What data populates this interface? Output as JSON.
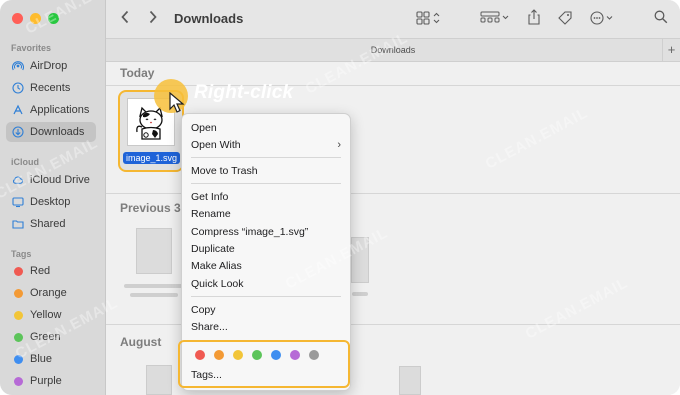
{
  "window": {
    "title": "Downloads",
    "pathbar": "Downloads"
  },
  "colors": {
    "close": "#ff5f57",
    "minimize": "#febc2e",
    "zoom": "#28c840",
    "highlight": "#f5b732",
    "selection": "#1f63d8"
  },
  "sidebar": {
    "favorites_label": "Favorites",
    "favorites": [
      {
        "label": "AirDrop",
        "icon": "airdrop-icon"
      },
      {
        "label": "Recents",
        "icon": "clock-icon"
      },
      {
        "label": "Applications",
        "icon": "applications-icon"
      },
      {
        "label": "Downloads",
        "icon": "download-icon",
        "active": true
      }
    ],
    "icloud_label": "iCloud",
    "icloud": [
      {
        "label": "iCloud Drive",
        "icon": "cloud-icon"
      },
      {
        "label": "Desktop",
        "icon": "desktop-icon"
      },
      {
        "label": "Shared",
        "icon": "shared-folder-icon"
      }
    ],
    "tags_label": "Tags",
    "tags": [
      {
        "label": "Red",
        "color": "#f05a52"
      },
      {
        "label": "Orange",
        "color": "#f39a35"
      },
      {
        "label": "Yellow",
        "color": "#f2c538"
      },
      {
        "label": "Green",
        "color": "#5cc45a"
      },
      {
        "label": "Blue",
        "color": "#3f8ef0"
      },
      {
        "label": "Purple",
        "color": "#b66ad6"
      }
    ]
  },
  "groups": {
    "today": "Today",
    "previous": "Previous 3",
    "august": "August"
  },
  "file": {
    "name": "image_1.svg"
  },
  "annotation": "Right-click",
  "context_menu": {
    "items_a": [
      "Open",
      "Open With"
    ],
    "items_b": [
      "Move to Trash"
    ],
    "items_c": [
      "Get Info",
      "Rename",
      "Compress “image_1.svg”",
      "Duplicate",
      "Make Alias",
      "Quick Look"
    ],
    "items_d": [
      "Copy",
      "Share..."
    ],
    "tag_colors": [
      "#f05a52",
      "#f39a35",
      "#f2c538",
      "#5cc45a",
      "#3f8ef0",
      "#b66ad6",
      "#9a9a9a"
    ],
    "tags_label": "Tags..."
  },
  "watermark": "CLEAN.EMAIL"
}
